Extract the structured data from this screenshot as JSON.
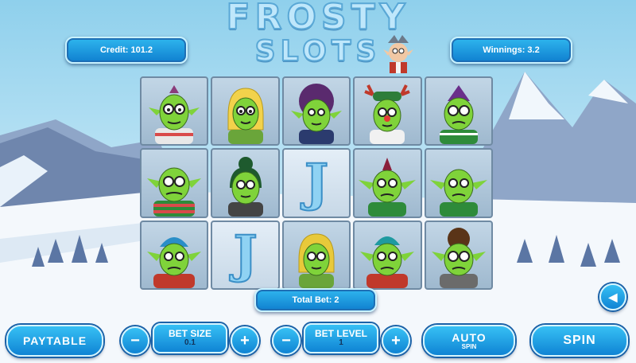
{
  "game": {
    "title_line1": "FROSTY",
    "title_line2": "SLOTS"
  },
  "header": {
    "credit": "Credit: 101.2",
    "winnings": "Winnings: 3.2"
  },
  "reels": [
    [
      "goblin-glasses",
      "goblin-blonde",
      "goblin-afro",
      "goblin-reindeer",
      "goblin-purple"
    ],
    [
      "goblin-striped",
      "goblin-bun",
      "J",
      "goblin-mohawk",
      "goblin-bald"
    ],
    [
      "goblin-blue",
      "J",
      "goblin-yellow",
      "goblin-teal",
      "goblin-brown"
    ]
  ],
  "total_bet": "Total Bet: 2",
  "controls": {
    "paytable": "PAYTABLE",
    "bet_size_label": "BET SIZE",
    "bet_size_value": "0.1",
    "bet_level_label": "BET LEVEL",
    "bet_level_value": "1",
    "auto_label": "AUTO",
    "auto_sub": "SPIN",
    "spin_label": "SPIN",
    "minus": "−",
    "plus": "+"
  },
  "colors": {
    "accent": "#1a9be0",
    "frame": "#d5f5ff",
    "goblin_skin": "#7fd33a"
  }
}
